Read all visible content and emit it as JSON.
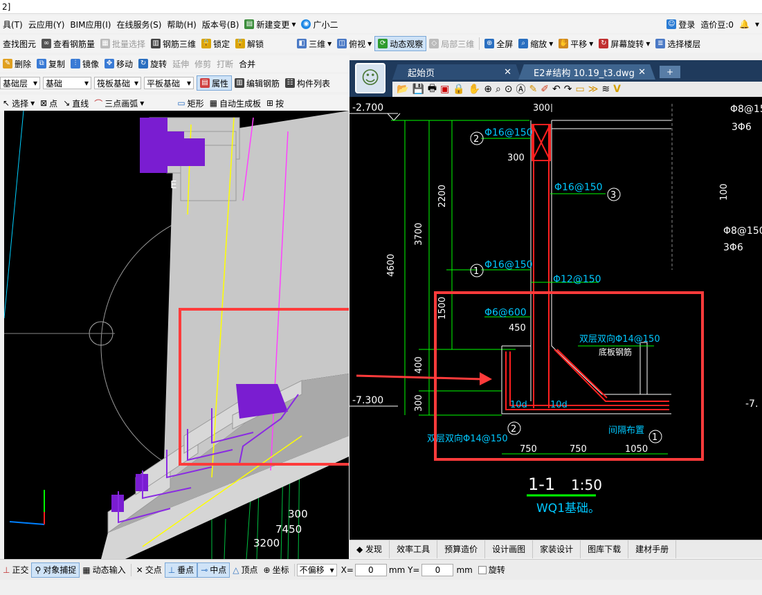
{
  "titlebar": {
    "text": "2]"
  },
  "menubar": {
    "items": [
      "具(T)",
      "云应用(Y)",
      "BIM应用(I)",
      "在线服务(S)",
      "帮助(H)",
      "版本号(B)",
      "新建变更",
      "广小二"
    ],
    "login": "登录",
    "price_beans": "造价豆:0"
  },
  "toolbar1": {
    "find_element": "查找图元",
    "view_rebar_qty": "查看钢筋量",
    "batch_select": "批量选择",
    "rebar_3d": "钢筋三维",
    "lock": "锁定",
    "unlock": "解锁",
    "view_3d": "三维",
    "top_view": "俯视",
    "dynamic_observe": "动态观察",
    "local_3d": "局部三维",
    "fullscreen": "全屏",
    "zoom": "缩放",
    "pan": "平移",
    "screen_rotate": "屏幕旋转",
    "select_floor": "选择楼层"
  },
  "toolbar2": {
    "delete": "删除",
    "copy": "复制",
    "mirror": "镜像",
    "move": "移动",
    "rotate": "旋转",
    "extend": "延伸",
    "trim": "修剪",
    "break": "打断",
    "merge": "合并"
  },
  "toolbar3": {
    "layer_select": "基础层",
    "category_select": "基础",
    "type_select": "筏板基础",
    "sub_select": "平板基础",
    "properties": "属性",
    "edit_rebar": "编辑钢筋",
    "component_list": "构件列表"
  },
  "toolbar4": {
    "select": "选择",
    "point": "点",
    "line": "直线",
    "arc_3pt": "三点画弧",
    "rect": "矩形",
    "auto_slab": "自动生成板",
    "press": "按"
  },
  "view3d": {
    "labels": [
      "E",
      "300",
      "7450",
      "3200"
    ]
  },
  "cad": {
    "tabs": [
      "起始页",
      "E2#结构 10.19_t3.dwg"
    ],
    "texts": {
      "elev_top": "-2.700",
      "elev_bottom": "-7.300",
      "dim_300_top": "300",
      "rebar_2": "Φ16@150",
      "dim_300_mid": "300",
      "rebar_3": "Φ16@150",
      "dim_2200": "2200",
      "dim_3700": "3700",
      "dim_4600": "4600",
      "rebar_1": "Φ16@150",
      "rebar_12": "Φ12@150",
      "dim_1500": "1500",
      "rebar_6": "Φ6@600",
      "dim_450": "450",
      "rebar_slab": "双层双向Φ14@150",
      "slab_label": "底板钢筋",
      "ten_d_left": "10d",
      "ten_d_right": "10d",
      "dim_400": "400",
      "dim_300_low": "300",
      "rebar_bottom": "双层双向Φ14@150",
      "spacing_note": "间隔布置",
      "dim_750a": "750",
      "dim_750b": "750",
      "dim_1050": "1050",
      "section": "1-1",
      "scale": "1:50",
      "caption": "WQ1基础。",
      "right_rebar1": "Φ8@15",
      "right_rebar2": "3Φ6",
      "right_dim100": "100",
      "right_rebar3": "Φ8@150",
      "right_rebar4": "3Φ6",
      "right_elev": "-7."
    },
    "bottom_tabs": [
      "发现",
      "效率工具",
      "预算造价",
      "设计画图",
      "家装设计",
      "图库下载",
      "建材手册"
    ]
  },
  "statusbar": {
    "ortho": "正交",
    "snap": "对象捕捉",
    "dyn_input": "动态输入",
    "intersection": "交点",
    "perpendicular": "垂点",
    "midpoint": "中点",
    "vertex": "顶点",
    "coordinate": "坐标",
    "offset_mode": "不偏移",
    "x_label": "X=",
    "x_value": "0",
    "y_label": "mm Y=",
    "y_value": "0",
    "unit": "mm",
    "rotate": "旋转"
  },
  "colors": {
    "highlight_box": "#ff3b3b",
    "cad_green": "#00ff00",
    "cad_cyan": "#00c8ff",
    "cad_red": "#ff2020",
    "rebar_purple": "#7a1dd1"
  }
}
